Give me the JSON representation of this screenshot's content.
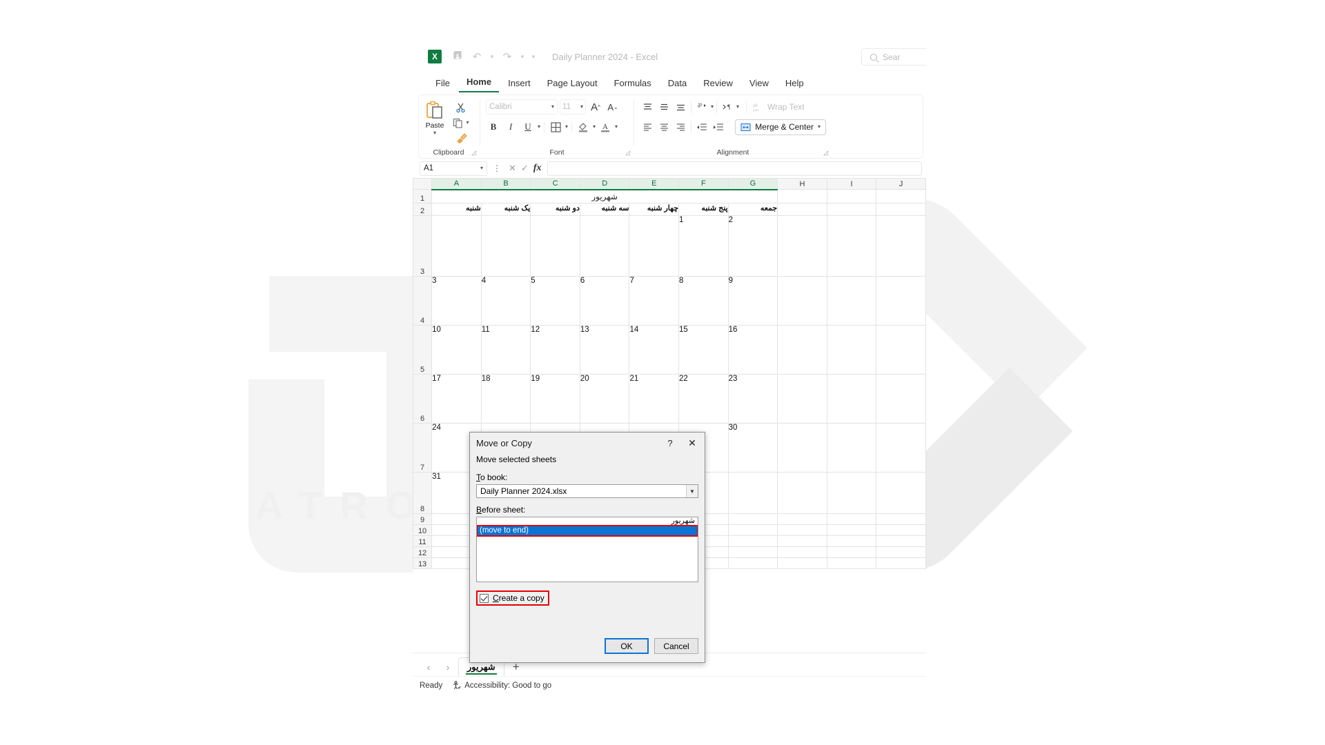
{
  "watermark": {
    "text": "ATRO ACADEMY"
  },
  "window": {
    "app_icon": "excel-logo-icon",
    "doc_title": "Daily Planner 2024  -  Excel",
    "quick_access": [
      {
        "name": "save-icon",
        "glyph": "὚B"
      },
      {
        "name": "undo-icon",
        "glyph": "↶"
      },
      {
        "name": "redo-icon",
        "glyph": "↷"
      },
      {
        "name": "customize-quick-access-icon",
        "glyph": "⌄"
      }
    ],
    "search_placeholder": "Sear"
  },
  "ribbon": {
    "tabs": [
      {
        "label": "File",
        "active": false
      },
      {
        "label": "Home",
        "active": true
      },
      {
        "label": "Insert",
        "active": false
      },
      {
        "label": "Page Layout",
        "active": false
      },
      {
        "label": "Formulas",
        "active": false
      },
      {
        "label": "Data",
        "active": false
      },
      {
        "label": "Review",
        "active": false
      },
      {
        "label": "View",
        "active": false
      },
      {
        "label": "Help",
        "active": false
      }
    ],
    "groups": {
      "clipboard": {
        "label": "Clipboard",
        "paste_label": "Paste",
        "cut_icon": "scissors-icon",
        "copy_icon": "copy-icon",
        "format_painter_icon": "format-painter-icon"
      },
      "font": {
        "label": "Font",
        "font_name": "Calibri",
        "font_size": "11",
        "grow_font": "A",
        "shrink_font": "A",
        "bold": "B",
        "italic": "I",
        "underline": "U",
        "borders_icon": "borders-icon",
        "fill_color_icon": "fill-color-icon",
        "font_color_icon": "font-color-icon"
      },
      "alignment": {
        "label": "Alignment",
        "wrap_text": "Wrap Text",
        "merge_center": "Merge & Center",
        "orientation_icon": "orientation-icon",
        "rtl_icon": "text-direction-icon"
      }
    }
  },
  "formula_bar": {
    "name_box": "A1",
    "cancel_icon": "cancel-icon",
    "enter_icon": "confirm-icon",
    "fx_label": "fx",
    "formula_value": ""
  },
  "sheet": {
    "columns": [
      "A",
      "B",
      "C",
      "D",
      "E",
      "F",
      "G",
      "H",
      "I",
      "J"
    ],
    "selected_columns": [
      "A",
      "B",
      "C",
      "D",
      "E",
      "F",
      "G"
    ],
    "row_headers": [
      "1",
      "2",
      "3",
      "4",
      "5",
      "6",
      "7",
      "8",
      "9",
      "10",
      "11",
      "12",
      "13"
    ],
    "merged_title": "شهریور",
    "day_names": [
      "شنبه",
      "یک شنبه",
      "دو شنبه",
      "سه شنبه",
      "چهار شنبه",
      "پنج شنبه",
      "جمعه"
    ],
    "weeks": [
      [
        "",
        "",
        "",
        "",
        "",
        "1",
        "2"
      ],
      [
        "3",
        "4",
        "5",
        "6",
        "7",
        "8",
        "9"
      ],
      [
        "10",
        "11",
        "12",
        "13",
        "14",
        "15",
        "16"
      ],
      [
        "17",
        "18",
        "19",
        "20",
        "21",
        "22",
        "23"
      ],
      [
        "24",
        "",
        "",
        "",
        "",
        "",
        "30"
      ],
      [
        "31",
        "",
        "",
        "",
        "",
        "",
        ""
      ]
    ]
  },
  "sheet_tabs": {
    "prev_icon": "chevron-left-icon",
    "next_icon": "chevron-right-icon",
    "tabs": [
      {
        "label": "شهریور",
        "active": true
      }
    ],
    "add_label": "+"
  },
  "status_bar": {
    "mode": "Ready",
    "accessibility": "Accessibility: Good to go",
    "accessibility_icon": "accessibility-icon"
  },
  "dialog": {
    "title": "Move or Copy",
    "help_glyph": "?",
    "close_glyph": "✕",
    "subtitle": "Move selected sheets",
    "to_book_label": "To book:",
    "to_book_underline": "T",
    "to_book_value": "Daily Planner 2024.xlsx",
    "before_sheet_label": "Before sheet:",
    "before_sheet_underline": "B",
    "list_items": [
      {
        "label": "شهریور",
        "selected": false,
        "rtl": true
      },
      {
        "label": "(move to end)",
        "selected": true,
        "rtl": false
      }
    ],
    "create_copy_label": "Create a copy",
    "create_copy_underline": "C",
    "create_copy_checked": true,
    "ok_label": "OK",
    "cancel_label": "Cancel",
    "highlight_color": "#e60000",
    "selection_color": "#0a74d5"
  }
}
